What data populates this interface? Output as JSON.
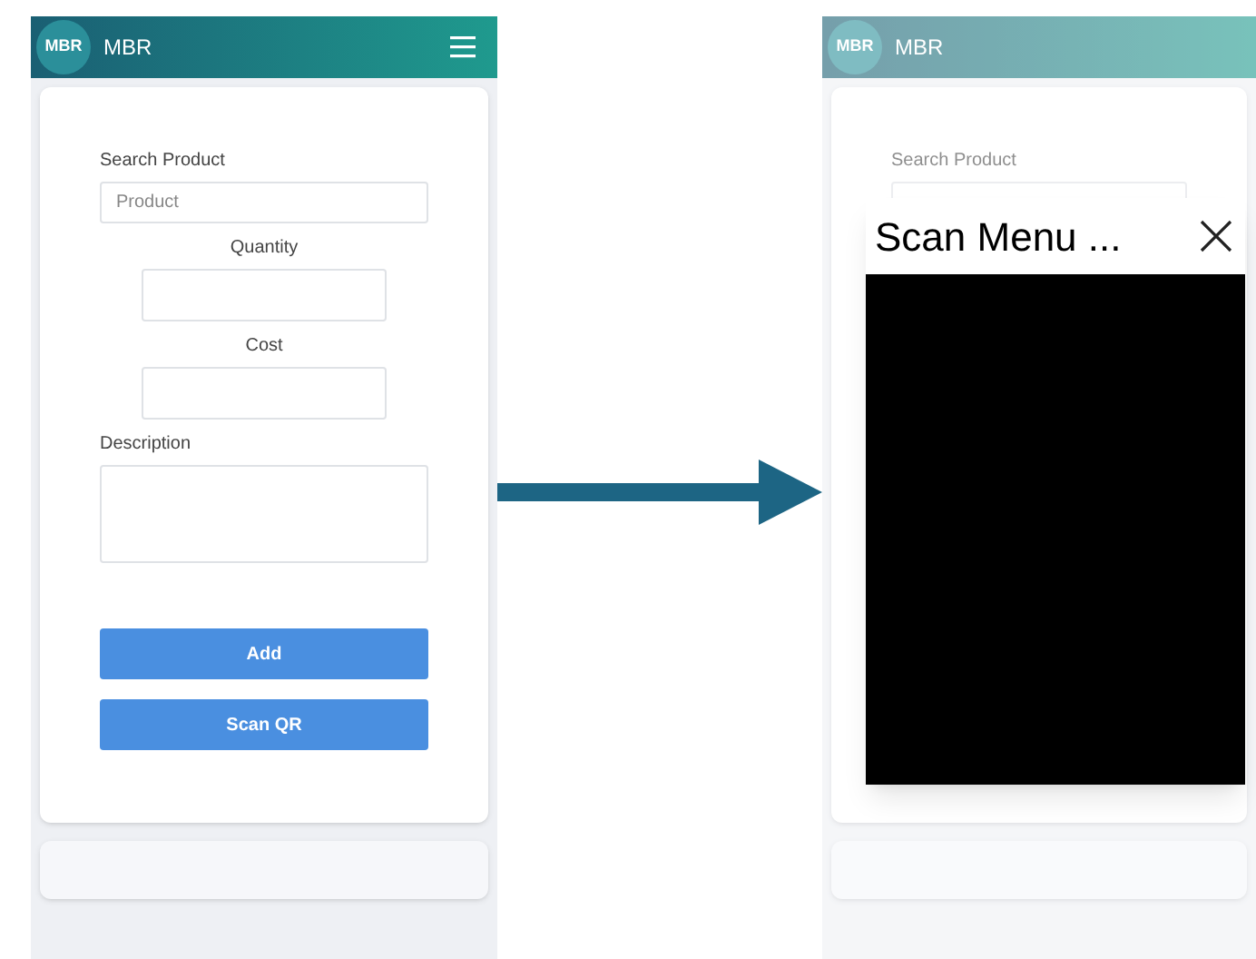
{
  "screens": [
    {
      "kind": "form",
      "header": {
        "logo": "MBR",
        "title": "MBR"
      },
      "fields": [
        {
          "kind": "wide",
          "label": "Search Product",
          "placeholder": "Product"
        },
        {
          "kind": "short",
          "label": "Quantity"
        },
        {
          "kind": "short",
          "label": "Cost"
        },
        {
          "kind": "multiline",
          "label": "Description"
        }
      ],
      "buttons": [
        "Add",
        "Scan QR"
      ]
    },
    {
      "kind": "scan",
      "header": {
        "logo": "MBR",
        "title": "MBR"
      },
      "field_label": "Search Product",
      "modal": {
        "title": "Scan Menu ..."
      }
    }
  ]
}
